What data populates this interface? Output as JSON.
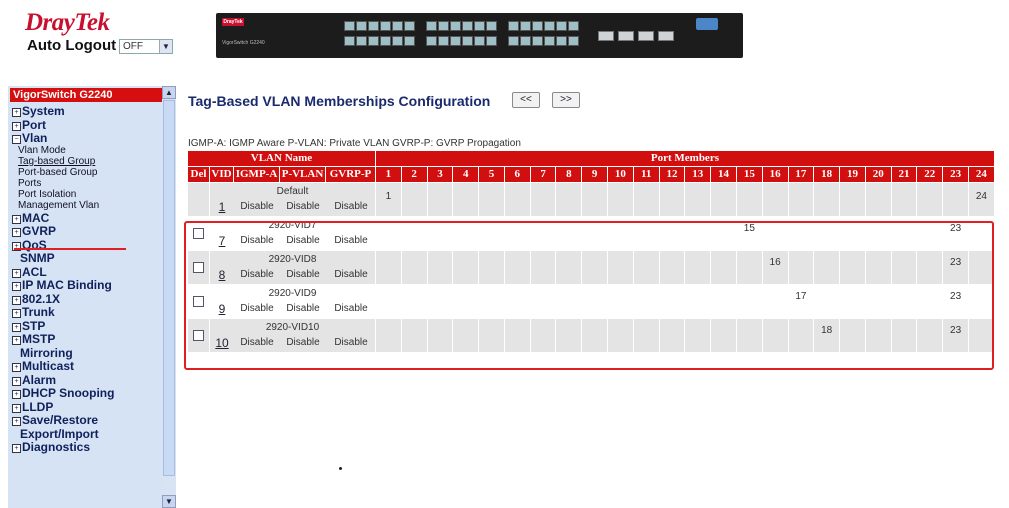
{
  "header": {
    "logo_dray": "Dray",
    "logo_tek": "Tek",
    "auto_logout_label": "Auto Logout",
    "auto_logout_value": "OFF",
    "device_brand": "DrayTek",
    "device_model": "VigorSwitch G2240"
  },
  "sidebar": {
    "title": "VigorSwitch G2240",
    "items": [
      {
        "label": "System",
        "type": "group",
        "expanded": false
      },
      {
        "label": "Port",
        "type": "group",
        "expanded": false
      },
      {
        "label": "Vlan",
        "type": "group",
        "expanded": true
      },
      {
        "label": "Vlan Mode",
        "type": "sub"
      },
      {
        "label": "Tag-based Group",
        "type": "sub",
        "active": true
      },
      {
        "label": "Port-based Group",
        "type": "sub"
      },
      {
        "label": "Ports",
        "type": "sub"
      },
      {
        "label": "Port Isolation",
        "type": "sub"
      },
      {
        "label": "Management Vlan",
        "type": "sub"
      },
      {
        "label": "MAC",
        "type": "group",
        "expanded": false
      },
      {
        "label": "GVRP",
        "type": "group",
        "expanded": false
      },
      {
        "label": "QoS",
        "type": "group",
        "expanded": false
      },
      {
        "label": "SNMP",
        "type": "plain"
      },
      {
        "label": "ACL",
        "type": "group",
        "expanded": false
      },
      {
        "label": "IP MAC Binding",
        "type": "group",
        "expanded": false
      },
      {
        "label": "802.1X",
        "type": "group",
        "expanded": false
      },
      {
        "label": "Trunk",
        "type": "group",
        "expanded": false
      },
      {
        "label": "STP",
        "type": "group",
        "expanded": false
      },
      {
        "label": "MSTP",
        "type": "group",
        "expanded": false
      },
      {
        "label": "Mirroring",
        "type": "plain"
      },
      {
        "label": "Multicast",
        "type": "group",
        "expanded": false
      },
      {
        "label": "Alarm",
        "type": "group",
        "expanded": false
      },
      {
        "label": "DHCP Snooping",
        "type": "group",
        "expanded": false
      },
      {
        "label": "LLDP",
        "type": "group",
        "expanded": false
      },
      {
        "label": "Save/Restore",
        "type": "group",
        "expanded": false
      },
      {
        "label": "Export/Import",
        "type": "plain"
      },
      {
        "label": "Diagnostics",
        "type": "group",
        "expanded": false
      }
    ]
  },
  "main": {
    "title": "Tag-Based VLAN Memberships Configuration",
    "prev_label": "<<",
    "next_label": ">>",
    "legend": "IGMP-A: IGMP Aware     P-VLAN: Private VLAN     GVRP-P: GVRP Propagation",
    "table": {
      "group_headers": {
        "vlan_name": "VLAN Name",
        "port_members": "Port Members"
      },
      "columns": [
        "Del",
        "VID",
        "IGMP-A",
        "P-VLAN",
        "GVRP-P"
      ],
      "port_count": 24,
      "rows": [
        {
          "name": "Default",
          "vid": "1",
          "deletable": false,
          "igmp": "Disable",
          "pvlan": "Disable",
          "gvrp": "Disable",
          "members": {
            "1": "1",
            "24": "24"
          }
        },
        {
          "name": "2920-VID7",
          "vid": "7",
          "deletable": true,
          "igmp": "Disable",
          "pvlan": "Disable",
          "gvrp": "Disable",
          "members": {
            "15": "15",
            "23": "23"
          }
        },
        {
          "name": "2920-VID8",
          "vid": "8",
          "deletable": true,
          "igmp": "Disable",
          "pvlan": "Disable",
          "gvrp": "Disable",
          "members": {
            "16": "16",
            "23": "23"
          }
        },
        {
          "name": "2920-VID9",
          "vid": "9",
          "deletable": true,
          "igmp": "Disable",
          "pvlan": "Disable",
          "gvrp": "Disable",
          "members": {
            "17": "17",
            "23": "23"
          }
        },
        {
          "name": "2920-VID10",
          "vid": "10",
          "deletable": true,
          "igmp": "Disable",
          "pvlan": "Disable",
          "gvrp": "Disable",
          "members": {
            "18": "18",
            "23": "23"
          }
        }
      ]
    }
  },
  "colors": {
    "accent": "#d10f0f",
    "sidebar_bg": "#d5e3f5",
    "title": "#1a2a6e",
    "highlight": "#e02020"
  }
}
